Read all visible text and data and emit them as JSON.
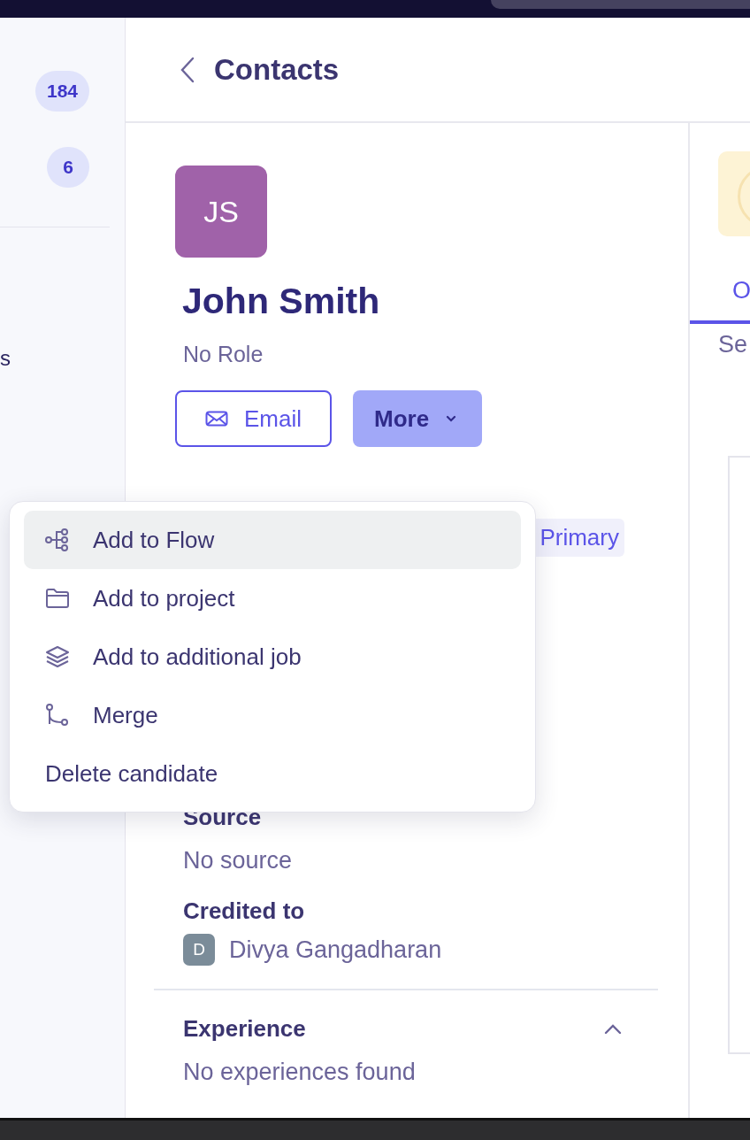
{
  "sidebar": {
    "badges": [
      "184",
      "6"
    ],
    "items": [
      "s"
    ]
  },
  "header": {
    "title": "Contacts"
  },
  "profile": {
    "initials": "JS",
    "name": "John Smith",
    "role": "No Role",
    "buttons": [
      {
        "label": "Email",
        "kind": "outline"
      },
      {
        "label": "More",
        "kind": "dropdown"
      }
    ],
    "tag": "Primary"
  },
  "sections": [
    {
      "heading": "Source",
      "value": "No source"
    },
    {
      "heading": "Credited to",
      "person": {
        "initial": "D",
        "name": "Divya Gangadharan"
      }
    }
  ],
  "experience": {
    "heading": "Experience",
    "expanded": true,
    "empty": "No experiences found"
  },
  "right_panel": {
    "tabs": [
      {
        "label": "O",
        "selected": true
      }
    ],
    "subtitle": "Se"
  },
  "menu": {
    "items": [
      {
        "label": "Add to Flow",
        "kind": "flow",
        "selected": true
      },
      {
        "label": "Add to project",
        "kind": "folder",
        "selected": false
      },
      {
        "label": "Add to additional job",
        "kind": "layers",
        "selected": false
      },
      {
        "label": "Merge",
        "kind": "merge",
        "selected": false
      },
      {
        "label": "Delete candidate",
        "kind": "plain",
        "selected": false
      }
    ]
  }
}
